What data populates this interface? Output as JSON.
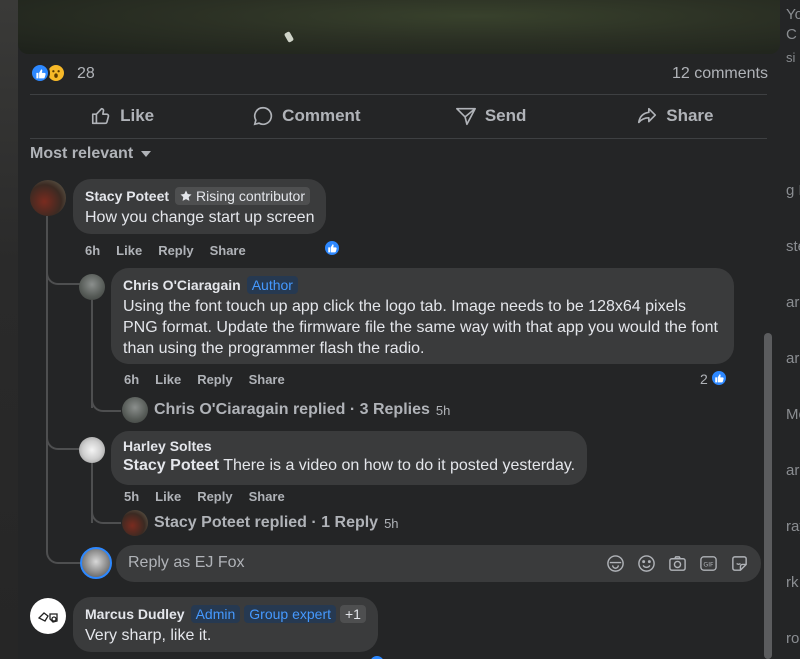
{
  "backdrop": {
    "right_peek": [
      "Yo",
      "C",
      "si",
      "g R",
      "ste",
      "ard",
      "ard",
      "Mo",
      "ard",
      "ray",
      "rk",
      "ro"
    ]
  },
  "post": {
    "reaction_icons": [
      "like-icon",
      "wow-icon"
    ],
    "reaction_count": "28",
    "comment_count": "12 comments"
  },
  "actions": [
    {
      "label": "Like",
      "icon": "thumbs-up-icon"
    },
    {
      "label": "Comment",
      "icon": "comment-bubble-icon"
    },
    {
      "label": "Send",
      "icon": "send-icon"
    },
    {
      "label": "Share",
      "icon": "share-arrow-icon"
    }
  ],
  "sort": {
    "label": "Most relevant"
  },
  "comments": [
    {
      "author": "Stacy Poteet",
      "badge": "Rising contributor",
      "text": "How you change start up screen",
      "meta": {
        "time": "6h",
        "like": "Like",
        "reply": "Reply",
        "share": "Share"
      },
      "reactions": ""
    },
    {
      "author": "Chris O'Ciaragain",
      "badge": "Author",
      "text": "Using the font touch up app click the logo tab. Image needs to be 128x64 pixels PNG format. Update the firmware file the same way with that app you would the font than using the programmer flash the radio.",
      "meta": {
        "time": "6h",
        "like": "Like",
        "reply": "Reply",
        "share": "Share"
      },
      "reactions": "2",
      "replied": {
        "text": "Chris O'Ciaragain replied · 3 Replies",
        "time": "5h"
      }
    },
    {
      "author": "Harley Soltes",
      "mention": "Stacy Poteet",
      "text": "There is a video on how to do it posted yesterday.",
      "meta": {
        "time": "5h",
        "like": "Like",
        "reply": "Reply",
        "share": "Share"
      },
      "replied": {
        "text": "Stacy Poteet replied · 1 Reply",
        "time": "5h"
      }
    },
    {
      "author": "Marcus Dudley",
      "badges": [
        "Admin",
        "Group expert",
        "+1"
      ],
      "text": "Very sharp, like it."
    }
  ],
  "reply_box": {
    "placeholder": "Reply as EJ Fox",
    "icons": [
      "avatar-sticker-icon",
      "emoji-icon",
      "camera-icon",
      "gif-icon",
      "sticker-icon"
    ]
  },
  "colors": {
    "accent": "#2d88ff",
    "panel": "#242526",
    "bubble": "#3a3b3c",
    "badge_blue_text": "#4599ff"
  }
}
